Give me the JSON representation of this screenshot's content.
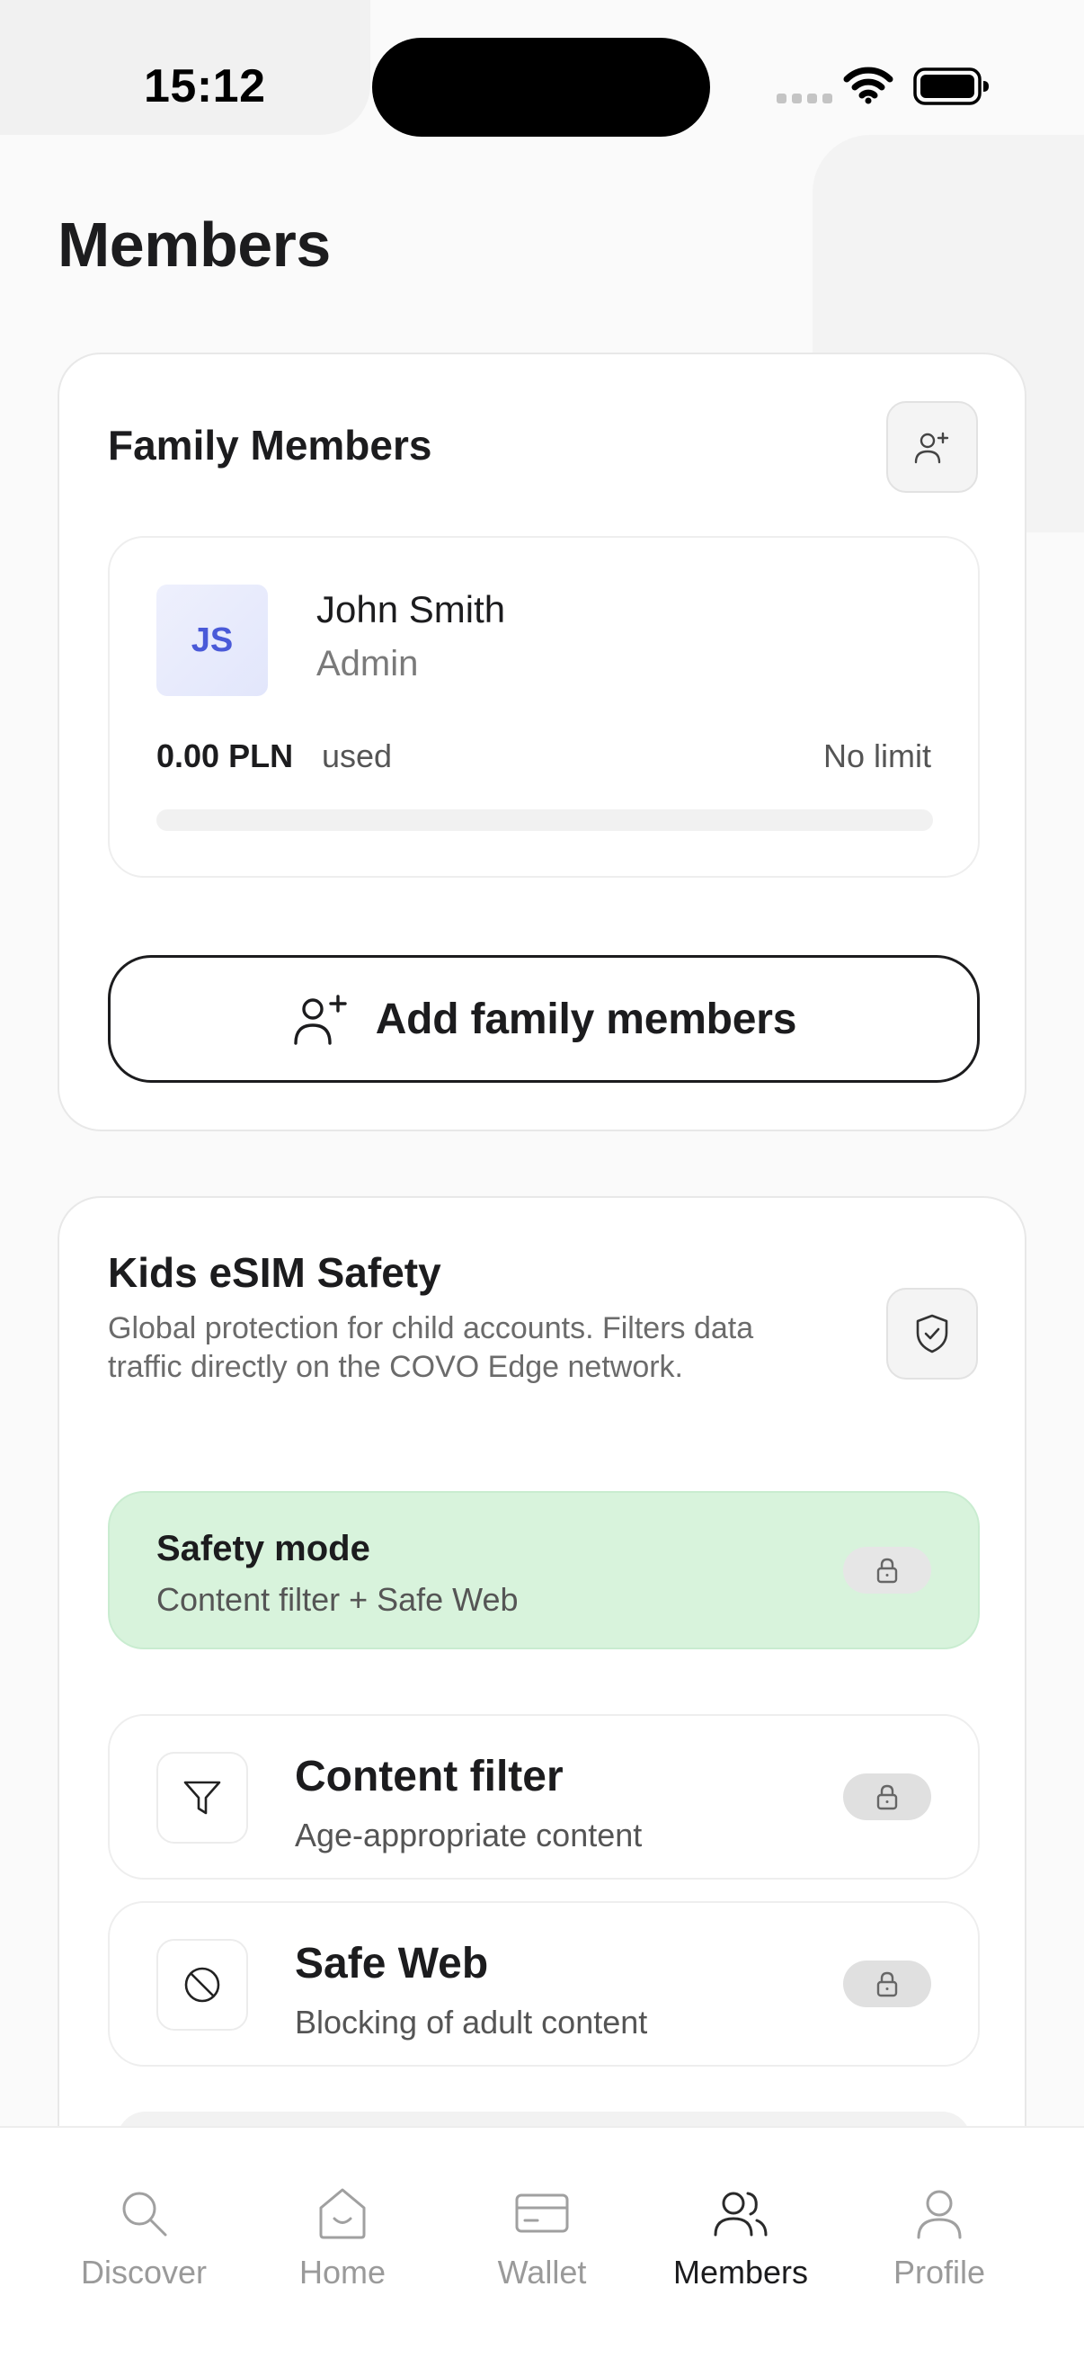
{
  "status_bar": {
    "time": "15:12"
  },
  "page": {
    "title": "Members"
  },
  "family": {
    "title": "Family Members",
    "member": {
      "initials": "JS",
      "name": "John Smith",
      "role": "Admin",
      "used_amount": "0.00 PLN",
      "used_suffix": "used",
      "limit": "No limit",
      "usage_fraction": 0
    },
    "add_button_label": "Add family members"
  },
  "kids": {
    "title": "Kids eSIM Safety",
    "description": "Global protection for child accounts. Filters data traffic directly on the COVO Edge network.",
    "safety_mode": {
      "title": "Safety mode",
      "subtitle": "Content filter + Safe Web"
    },
    "features": [
      {
        "title": "Content filter",
        "subtitle": "Age-appropriate content",
        "icon": "filter-icon"
      },
      {
        "title": "Safe Web",
        "subtitle": "Blocking of adult content",
        "icon": "block-icon"
      }
    ]
  },
  "tabs": [
    {
      "label": "Discover",
      "icon": "search-icon",
      "active": false
    },
    {
      "label": "Home",
      "icon": "home-icon",
      "active": false
    },
    {
      "label": "Wallet",
      "icon": "wallet-icon",
      "active": false
    },
    {
      "label": "Members",
      "icon": "members-icon",
      "active": true
    },
    {
      "label": "Profile",
      "icon": "profile-icon",
      "active": false
    }
  ],
  "colors": {
    "accent": "#4a5ad8",
    "safety_bg": "#d8f3dc",
    "text_primary": "#1c1c1e",
    "text_secondary": "#6b6b6b",
    "tab_inactive": "#9a9a9a"
  }
}
